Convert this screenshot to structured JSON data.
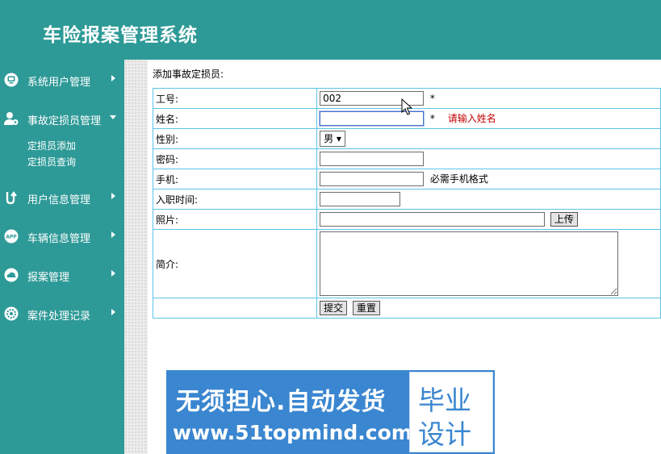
{
  "header": {
    "title": "车险报案管理系统"
  },
  "sidebar": {
    "items": [
      {
        "label": "系统用户管理",
        "icon": "monitor-icon"
      },
      {
        "label": "事故定损员管理",
        "icon": "user-gear-icon",
        "expanded": true,
        "children": [
          {
            "label": "定损员添加"
          },
          {
            "label": "定损员查询"
          }
        ]
      },
      {
        "label": "用户信息管理",
        "icon": "u-turn-icon"
      },
      {
        "label": "车辆信息管理",
        "icon": "app-icon",
        "icon_text": "APP"
      },
      {
        "label": "报案管理",
        "icon": "cloud-icon"
      },
      {
        "label": "案件处理记录",
        "icon": "gear-icon"
      }
    ]
  },
  "form": {
    "heading": "添加事故定损员:",
    "fields": {
      "job_no": {
        "label": "工号:",
        "value": "002",
        "required_mark": "*"
      },
      "name": {
        "label": "姓名:",
        "value": "",
        "required_mark": "*",
        "error": "请输入姓名"
      },
      "gender": {
        "label": "性别:",
        "value": "男"
      },
      "password": {
        "label": "密码:",
        "value": ""
      },
      "phone": {
        "label": "手机:",
        "value": "",
        "hint": "必需手机格式"
      },
      "join_date": {
        "label": "入职时间:",
        "value": ""
      },
      "photo": {
        "label": "照片:",
        "value": "",
        "upload_label": "上传"
      },
      "intro": {
        "label": "简介:",
        "value": ""
      }
    },
    "submit_label": "提交",
    "reset_label": "重置"
  },
  "ad": {
    "slogan": "无须担心.自动发货",
    "url": "www.51topmind.com",
    "box_line1": "毕业",
    "box_line2": "设计"
  },
  "colors": {
    "primary": "#2e9a97",
    "table_border": "#5cc4e6",
    "error": "#c40000",
    "ad_blue": "#3a86d0"
  }
}
